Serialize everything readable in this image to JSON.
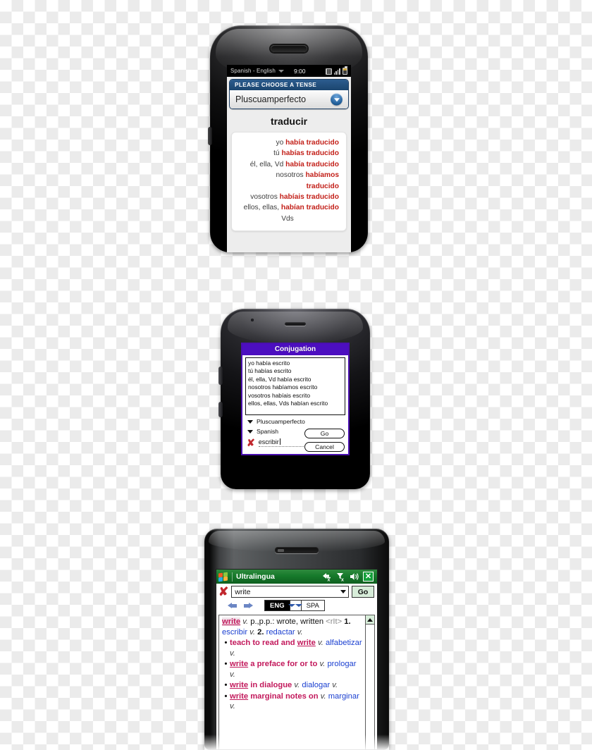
{
  "phone1": {
    "device_name": "palm-smartphone",
    "statusbar": {
      "language_pair": "Spanish - English",
      "time": "9:00",
      "icons": [
        "network-icon",
        "signal-icon",
        "battery-icon"
      ]
    },
    "tense_panel": {
      "header": "PLEASE CHOOSE A TENSE",
      "selected_tense": "Pluscuamperfecto",
      "dropdown_icon": "chevron-down-icon"
    },
    "verb": "traducir",
    "conjugations": [
      {
        "pronoun": "yo",
        "form": "había traducido",
        "align": "right"
      },
      {
        "pronoun": "tú",
        "form": "habías traducido",
        "align": "right"
      },
      {
        "pronoun": "él, ella, Vd",
        "form": "había traducido",
        "align": "right"
      },
      {
        "pronoun": "nosotros",
        "form": "habíamos",
        "align": "right"
      },
      {
        "pronoun": "",
        "form": "traducido",
        "align": "right"
      },
      {
        "pronoun": "vosotros",
        "form": "habíais traducido",
        "align": "right"
      },
      {
        "pronoun": "ellos, ellas,",
        "form": "habían traducido",
        "align": "right"
      },
      {
        "pronoun": "Vds",
        "form": "",
        "align": "center"
      }
    ],
    "colors": {
      "accent": "#1b456f",
      "conjugation": "#c3211a"
    }
  },
  "phone2": {
    "device_name": "palm-treo-smartphone",
    "dialog_title": "Conjugation",
    "conjugation_list": [
      "yo había escrito",
      "tú habías escrito",
      "él, ella, Vd había escrito",
      "nosotros habíamos escrito",
      "vosotros habíais escrito",
      "ellos, ellas, Vds habían escrito"
    ],
    "tense_option": "Pluscuamperfecto",
    "language_option": "Spanish",
    "buttons": {
      "go": "Go",
      "cancel": "Cancel"
    },
    "input": {
      "value": "escribir",
      "clear_icon": "red-x-icon"
    },
    "colors": {
      "title_bar": "#4c0ec0"
    }
  },
  "phone3": {
    "device_name": "windows-mobile-smartphone",
    "titlebar": {
      "app_name": "Ultralingua",
      "logo": "windows-logo-icon",
      "icons": [
        "connectivity-off-icon",
        "signal-off-icon",
        "volume-icon"
      ],
      "close_label": "✕"
    },
    "searchbar": {
      "clear_icon": "red-x-icon",
      "query": "write",
      "combo_arrow": "chevron-down-icon",
      "go_label": "Go"
    },
    "navbar": {
      "back_icon": "arrow-left-icon",
      "forward_icon": "arrow-right-icon",
      "lang_from": "ENG",
      "lang_swap_icon": "swap-arrows-icon",
      "lang_to": "SPA"
    },
    "entry": {
      "headword": "write",
      "pos": "v.",
      "grammar": "p.,p.p.: wrote, written",
      "tag": "<rIt>",
      "senses": [
        {
          "num": "1.",
          "translation": "escribir",
          "pos": "v."
        },
        {
          "num": "2.",
          "translation": "redactar",
          "pos": "v."
        }
      ],
      "trailing_pos": "v."
    },
    "sub_entries": [
      {
        "en_pre": "teach to read and",
        "en_hw": "write",
        "en_post": "",
        "en_pos": "v.",
        "translation": "alfabetizar",
        "tr_pos": "v.",
        "mid_pos": ""
      },
      {
        "en_pre": "",
        "en_hw": "write",
        "en_post": "a preface for or to",
        "en_pos": "",
        "mid_pos": "v.",
        "translation": "prologar",
        "tr_pos": "v."
      },
      {
        "en_pre": "",
        "en_hw": "write",
        "en_post": "in dialogue",
        "en_pos": "v.",
        "translation": "dialogar",
        "tr_pos": "v.",
        "mid_pos": ""
      },
      {
        "en_pre": "",
        "en_hw": "write",
        "en_post": "marginal notes on",
        "en_pos": "",
        "mid_pos": "v.",
        "translation": "marginar",
        "tr_pos": "v."
      }
    ],
    "scrollbar": {
      "up_icon": "scroll-up-icon"
    },
    "colors": {
      "titlebar": "#167a2b",
      "headword": "#c2185b",
      "translation": "#1a3fd0",
      "go_button": "#d7edd9"
    }
  }
}
